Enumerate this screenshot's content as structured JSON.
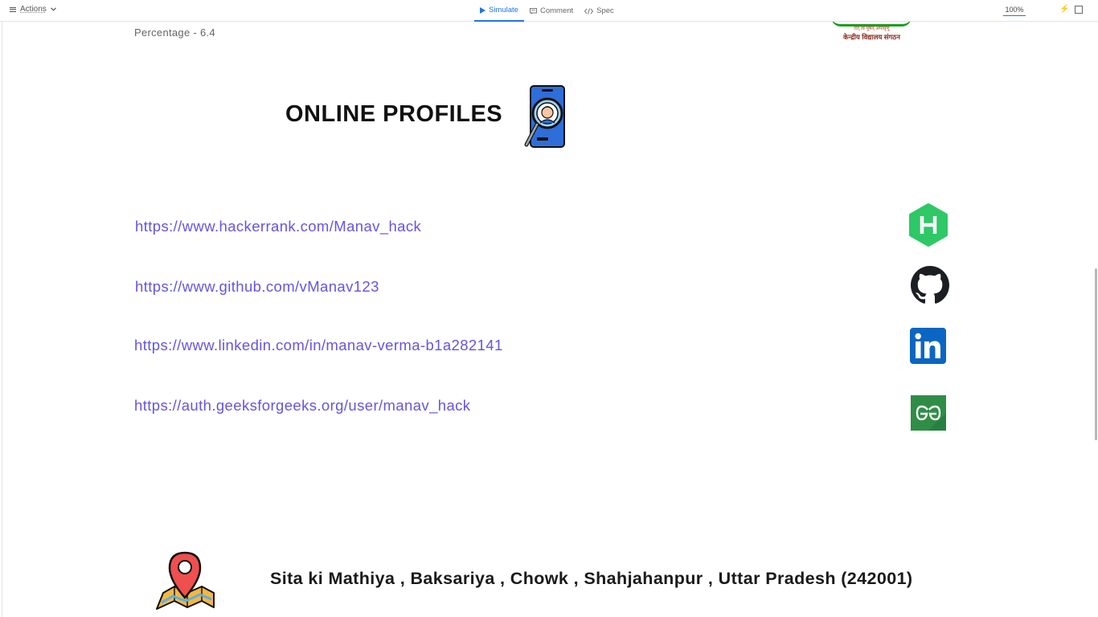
{
  "toolbar": {
    "actions_label": "Actions",
    "tabs": [
      {
        "label": "Simulate",
        "icon": "play-icon",
        "active": true
      },
      {
        "label": "Comment",
        "icon": "comment-icon",
        "active": false
      },
      {
        "label": "Spec",
        "icon": "code-icon",
        "active": false
      }
    ],
    "zoom": "100%",
    "accent_color": "#2374e1"
  },
  "page": {
    "percentage": "Percentage - 6.4",
    "kvs_logo": {
      "motto": "तत् त्वं पूषन् अपावृणु",
      "name": "केन्द्रीय विद्यालय संगठन"
    },
    "heading": "ONLINE PROFILES",
    "profiles": [
      {
        "url": "https://www.hackerrank.com/Manav_hack",
        "icon": "hackerrank-icon",
        "color": "#2ec866"
      },
      {
        "url": "https://www.github.com/vManav123",
        "icon": "github-icon",
        "color": "#1b1f23"
      },
      {
        "url": "https://www.linkedin.com/in/manav-verma-b1a282141",
        "icon": "linkedin-icon",
        "color": "#0a66c2"
      },
      {
        "url": "https://auth.geeksforgeeks.org/user/manav_hack",
        "icon": "geeksforgeeks-icon",
        "color": "#2f8d46"
      }
    ],
    "link_color": "#6355e6",
    "address": "Sita ki Mathiya , Baksariya , Chowk , Shahjahanpur , Uttar Pradesh (242001)"
  }
}
